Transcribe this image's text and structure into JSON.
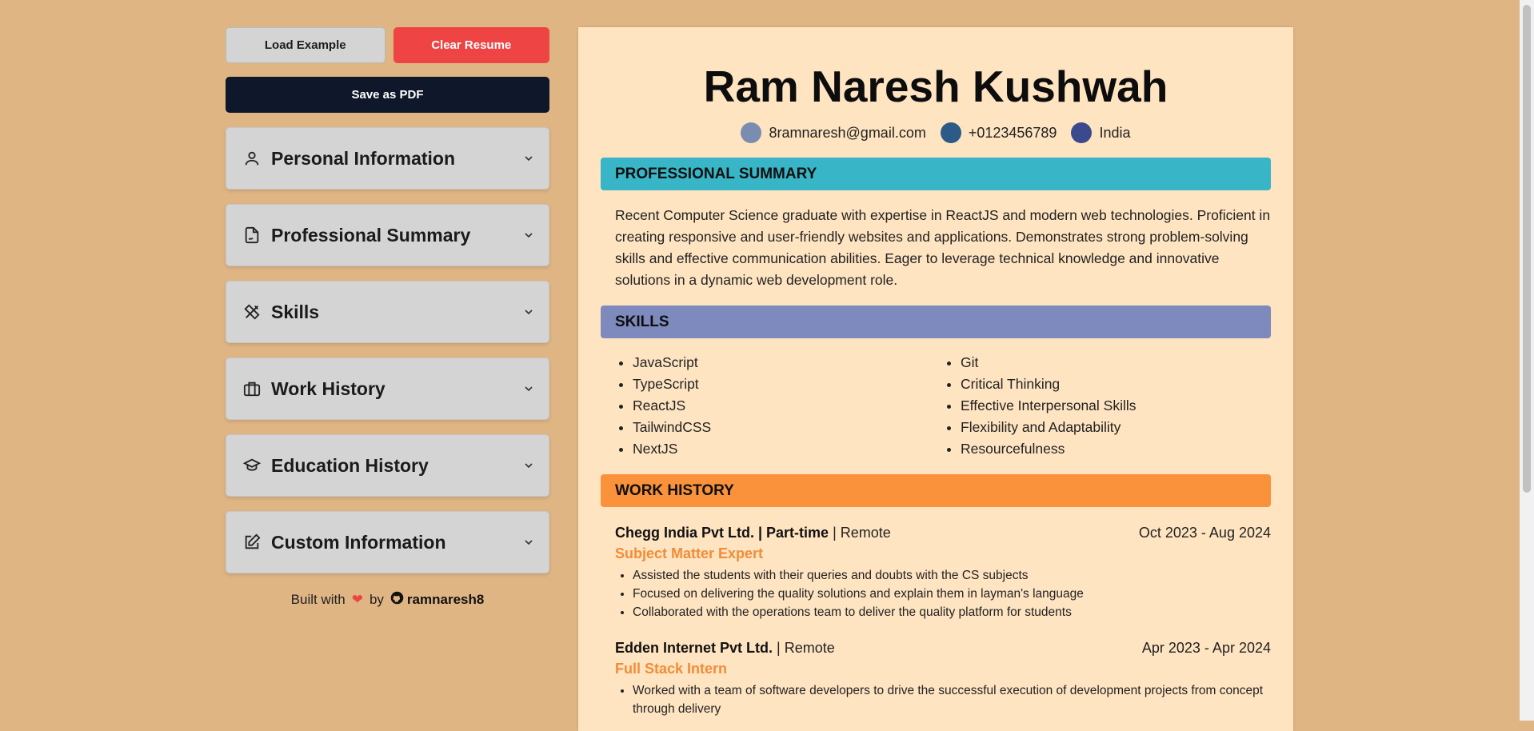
{
  "controls": {
    "load_label": "Load Example",
    "clear_label": "Clear Resume",
    "save_label": "Save as PDF"
  },
  "sections": [
    {
      "label": "Personal Information",
      "icon": "user-icon"
    },
    {
      "label": "Professional Summary",
      "icon": "file-signature-icon"
    },
    {
      "label": "Skills",
      "icon": "pencil-ruler-icon"
    },
    {
      "label": "Work History",
      "icon": "briefcase-icon"
    },
    {
      "label": "Education History",
      "icon": "graduation-cap-icon"
    },
    {
      "label": "Custom Information",
      "icon": "edit-square-icon"
    }
  ],
  "footer": {
    "built_with": "Built with",
    "by": "by",
    "author": "ramnaresh8"
  },
  "resume": {
    "name": "Ram Naresh Kushwah",
    "email": "8ramnaresh@gmail.com",
    "phone": "+0123456789",
    "location": "India",
    "summary_heading": "PROFESSIONAL SUMMARY",
    "summary_text": "Recent Computer Science graduate with expertise in ReactJS and modern web technologies. Proficient in creating responsive and user-friendly websites and applications. Demonstrates strong problem-solving skills and effective communication abilities. Eager to leverage technical knowledge and innovative solutions in a dynamic web development role.",
    "skills_heading": "SKILLS",
    "skills_left": [
      "JavaScript",
      "TypeScript",
      "ReactJS",
      "TailwindCSS",
      "NextJS"
    ],
    "skills_right": [
      "Git",
      "Critical Thinking",
      "Effective Interpersonal Skills",
      "Flexibility and Adaptability",
      "Resourcefulness"
    ],
    "work_heading": "WORK HISTORY",
    "jobs": [
      {
        "company": "Chegg India Pvt Ltd. | Part-time",
        "location": "| Remote",
        "dates": "Oct 2023 - Aug 2024",
        "role": "Subject Matter Expert",
        "points": [
          "Assisted the students with their queries and doubts with the CS subjects",
          "Focused on delivering the quality solutions and explain them in layman's language",
          "Collaborated with the operations team to deliver the quality platform for students"
        ]
      },
      {
        "company": "Edden Internet Pvt Ltd.",
        "location": "| Remote",
        "dates": "Apr 2023 - Apr 2024",
        "role": "Full Stack Intern",
        "points": [
          "Worked with a team of software developers to drive the successful execution of development projects from concept through delivery"
        ]
      }
    ]
  },
  "colors": {
    "page_bg": "#dfb584",
    "resume_bg": "#ffe4c1",
    "summary_header": "#38b6c7",
    "skills_header": "#7e89bd",
    "work_header": "#f9923a",
    "email_dot": "#7a8db0",
    "phone_dot": "#2b5b86",
    "location_dot": "#3b4a8c",
    "accent_role": "#f28c38"
  }
}
